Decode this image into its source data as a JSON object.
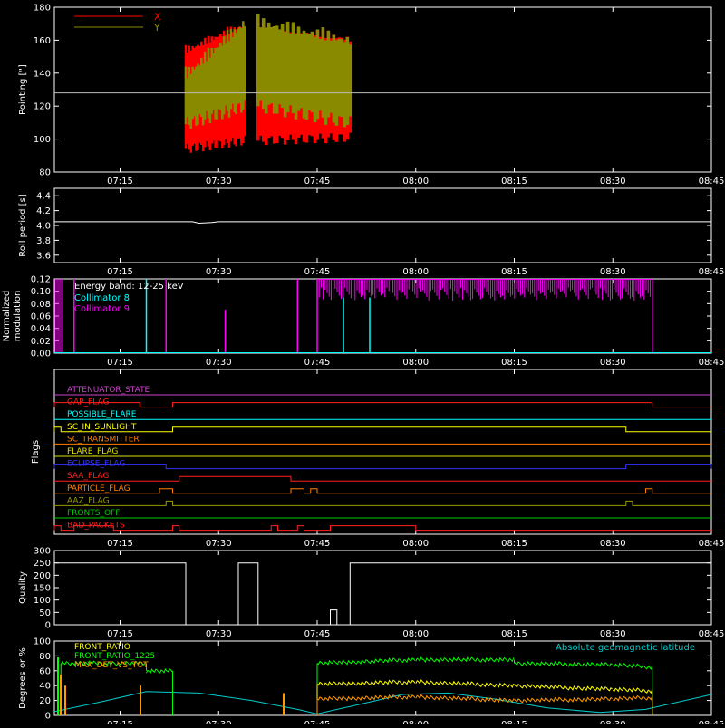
{
  "time_axis": {
    "start": "07:05",
    "end": "08:45",
    "tick_labels": [
      "07:15",
      "07:30",
      "07:45",
      "08:00",
      "08:15",
      "08:30",
      "08:45"
    ]
  },
  "chart_data": [
    {
      "id": "pointing",
      "type": "line",
      "title": "",
      "ylabel": "Pointing [\"]",
      "ylim": [
        80,
        180
      ],
      "yticks": [
        80,
        100,
        120,
        140,
        160,
        180
      ],
      "legend": {
        "placement": "top-left",
        "entries": [
          {
            "name": "X",
            "color": "#ff0000"
          },
          {
            "name": "Y",
            "color": "#8a8a00"
          }
        ]
      },
      "reference_line": {
        "y": 128,
        "color": "#bdbdbd"
      },
      "segments": [
        {
          "x": [
            "07:25",
            "07:34"
          ],
          "x_min": [
            94,
            99
          ],
          "x_max": [
            157,
            173
          ],
          "y_min": [
            109,
            120
          ],
          "y_max": [
            144,
            176
          ]
        },
        {
          "x": [
            "07:36",
            "07:50"
          ],
          "x_min": [
            99,
            101
          ],
          "x_max": [
            173,
            164
          ],
          "y_min": [
            120,
            110
          ],
          "y_max": [
            176,
            165
          ]
        }
      ]
    },
    {
      "id": "roll_period",
      "type": "line",
      "ylabel": "Roll period [s]",
      "ylim": [
        3.5,
        4.5
      ],
      "yticks": [
        3.6,
        3.8,
        4.0,
        4.2,
        4.4
      ],
      "series": [
        {
          "name": "",
          "color": "#ffffff",
          "x": [
            "07:05",
            "07:26",
            "07:27",
            "07:29",
            "07:30",
            "08:45"
          ],
          "y": [
            4.05,
            4.05,
            4.03,
            4.04,
            4.05,
            4.05
          ]
        }
      ]
    },
    {
      "id": "modulation",
      "type": "line",
      "ylabel": "Normalized modulation",
      "ylim": [
        0,
        0.12
      ],
      "yticks": [
        0.0,
        0.02,
        0.04,
        0.06,
        0.08,
        0.1,
        0.12
      ],
      "annotation": "Energy band: 12-25 keV",
      "legend": {
        "placement": "top-left",
        "entries": [
          {
            "name": "Collimator 8",
            "color": "#00ffff"
          },
          {
            "name": "Collimator 9",
            "color": "#ff00ff"
          }
        ]
      },
      "spikes": [
        {
          "series": "Collimator 9",
          "x": "07:08",
          "y": 0.12
        },
        {
          "series": "Collimator 8",
          "x": "07:19",
          "y": 0.12
        },
        {
          "series": "Collimator 9",
          "x": "07:22",
          "y": 0.12
        },
        {
          "series": "Collimator 9",
          "x": "07:31",
          "y": 0.07
        },
        {
          "series": "Collimator 9",
          "x": "07:42",
          "y": 0.12
        },
        {
          "series": "Collimator 9",
          "x": "07:45",
          "y": 0.12
        },
        {
          "series": "Collimator 8",
          "x": "07:49",
          "y": 0.09
        },
        {
          "series": "Collimator 8",
          "x": "07:53",
          "y": 0.09
        },
        {
          "series": "Collimator 9",
          "x": "08:36",
          "y": 0.12
        }
      ],
      "dense_region": {
        "series": "Collimator 9",
        "x": [
          "07:45",
          "08:36"
        ],
        "y_range": [
          0.085,
          0.12
        ]
      }
    },
    {
      "id": "flags",
      "type": "table",
      "ylabel": "Flags",
      "rows": [
        {
          "name": "ATTENUATOR_STATE",
          "color": "#cc44cc",
          "high": []
        },
        {
          "name": "SAA_FLAG_2",
          "label": "GAP_FLAG",
          "color": "#ff2020",
          "high": [
            [
              "07:05",
              "07:18"
            ],
            [
              "07:23",
              "08:36"
            ]
          ]
        },
        {
          "name": "POSSIBLE_FLARE",
          "color": "#00ffff",
          "high": []
        },
        {
          "name": "SC_IN_SUNLIGHT",
          "color": "#ffff00",
          "high": [
            [
              "07:05",
              "07:06"
            ],
            [
              "07:23",
              "08:32"
            ]
          ]
        },
        {
          "name": "SC_TRANSMITTER",
          "color": "#ff7f00",
          "high": []
        },
        {
          "name": "FLARE_FLAG",
          "color": "#e0e000",
          "high": []
        },
        {
          "name": "ECLIPSE_FLAG",
          "color": "#3333ff",
          "high": [
            [
              "07:05",
              "07:22"
            ],
            [
              "08:32",
              "08:45"
            ]
          ]
        },
        {
          "name": "SAA_FLAG",
          "color": "#ff2020",
          "high": [
            [
              "07:24",
              "07:41"
            ]
          ]
        },
        {
          "name": "PARTICLE_FLAG",
          "color": "#ff7f00",
          "high": [
            [
              "07:21",
              "07:23"
            ],
            [
              "07:41",
              "07:43"
            ],
            [
              "07:44",
              "07:45"
            ],
            [
              "08:35",
              "08:36"
            ]
          ]
        },
        {
          "name": "AAZ_FLAG",
          "color": "#999900",
          "high": [
            [
              "07:22",
              "07:23"
            ],
            [
              "08:32",
              "08:33"
            ]
          ]
        },
        {
          "name": "FRONTS_OFF",
          "color": "#00cc00",
          "high": []
        },
        {
          "name": "BAD_PACKETS",
          "color": "#ff2020",
          "high": [
            [
              "07:05",
              "07:06"
            ],
            [
              "07:08",
              "07:14"
            ],
            [
              "07:23",
              "07:24"
            ],
            [
              "07:38",
              "07:39"
            ],
            [
              "07:42",
              "07:43"
            ],
            [
              "07:47",
              "08:00"
            ]
          ]
        }
      ]
    },
    {
      "id": "quality",
      "type": "line",
      "ylabel": "Quality",
      "ylim": [
        0,
        300
      ],
      "yticks": [
        0,
        50,
        100,
        150,
        200,
        250,
        300
      ],
      "series": [
        {
          "name": "",
          "color": "#ffffff",
          "x": [
            "07:05",
            "07:25",
            "07:25",
            "07:33",
            "07:33",
            "07:34",
            "07:34",
            "07:36",
            "07:36",
            "07:47",
            "07:47",
            "07:48",
            "07:48",
            "07:50",
            "07:50",
            "08:45"
          ],
          "y": [
            250,
            250,
            0,
            0,
            250,
            250,
            250,
            250,
            0,
            0,
            60,
            60,
            0,
            0,
            250,
            250
          ]
        }
      ]
    },
    {
      "id": "ratios",
      "type": "line",
      "ylabel": "Degrees or %",
      "ylim": [
        0,
        100
      ],
      "yticks": [
        0,
        20,
        40,
        60,
        80,
        100
      ],
      "annotation": "Absolute geomagnetic latitude",
      "legend": {
        "placement": "top-left",
        "entries": [
          {
            "name": "FRONT_RATIO",
            "color": "#ffff00"
          },
          {
            "name": "FRONT_RATIO_1225",
            "color": "#00ff00"
          },
          {
            "name": "MAX_DET_VS_TOT",
            "color": "#ff9900"
          }
        ]
      },
      "series": [
        {
          "name": "Absolute geomagnetic latitude",
          "color": "#00cccc",
          "x": [
            "07:05",
            "07:12",
            "07:19",
            "07:27",
            "07:35",
            "07:42",
            "07:45",
            "07:50",
            "07:58",
            "08:05",
            "08:12",
            "08:20",
            "08:28",
            "08:35",
            "08:45"
          ],
          "y": [
            5,
            18,
            32,
            30,
            20,
            8,
            2,
            12,
            28,
            30,
            22,
            10,
            4,
            8,
            28
          ]
        },
        {
          "name": "FRONT_RATIO_1225",
          "color": "#00ff00",
          "x": [
            "07:05",
            "07:06",
            "07:06",
            "07:18",
            "07:19",
            "07:19",
            "07:23",
            "07:23",
            "07:45",
            "07:45",
            "08:00",
            "08:15",
            "08:15",
            "08:30",
            "08:36",
            "08:36",
            "08:45"
          ],
          "y": [
            0,
            0,
            70,
            70,
            70,
            60,
            60,
            0,
            0,
            70,
            75,
            75,
            70,
            68,
            65,
            0,
            0
          ]
        },
        {
          "name": "FRONT_RATIO",
          "color": "#ffff00",
          "x": [
            "07:05",
            "07:45",
            "07:45",
            "08:00",
            "08:15",
            "08:30",
            "08:36",
            "08:36",
            "08:45"
          ],
          "y": [
            0,
            0,
            42,
            45,
            40,
            35,
            33,
            0,
            0
          ]
        },
        {
          "name": "MAX_DET_VS_TOT",
          "color": "#ff9900",
          "x": [
            "07:05",
            "07:45",
            "07:45",
            "08:00",
            "08:15",
            "08:30",
            "08:36",
            "08:36",
            "08:45"
          ],
          "y": [
            0,
            0,
            22,
            25,
            20,
            22,
            24,
            0,
            0
          ]
        }
      ]
    }
  ]
}
